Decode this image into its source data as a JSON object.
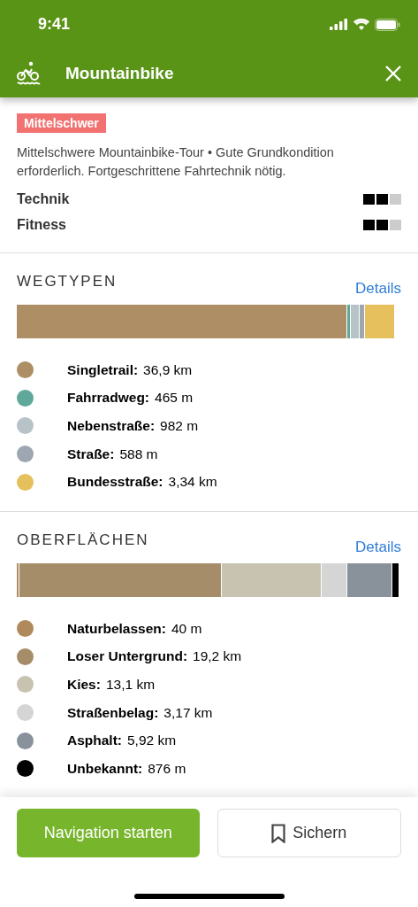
{
  "status_bar": {
    "time": "9:41"
  },
  "header": {
    "title": "Mountainbike"
  },
  "difficulty": {
    "badge": "Mittelschwer",
    "description": "Mittelschwere Mountainbike-Tour • Gute Grundkondition erforderlich. Fortgeschrittene Fahrtechnik nötig.",
    "ratings": [
      {
        "label": "Technik",
        "stars": 2
      },
      {
        "label": "Fitness",
        "stars": 2
      }
    ]
  },
  "sections": [
    {
      "title": "WEGTYPEN",
      "link": "Details",
      "segments": [
        {
          "name": "Singletrail:",
          "value": "36,9 km",
          "color": "#ad8e65"
        },
        {
          "name": "Fahrradweg:",
          "value": "465 m",
          "color": "#5fa89a"
        },
        {
          "name": "Nebenstraße:",
          "value": "982 m",
          "color": "#b8c3c8"
        },
        {
          "name": "Straße:",
          "value": "588 m",
          "color": "#9ea7b1"
        },
        {
          "name": "Bundesstraße:",
          "value": "3,34 km",
          "color": "#e5c05d"
        }
      ]
    },
    {
      "title": "OBERFLÄCHEN",
      "link": "Details",
      "segments": [
        {
          "name": "Naturbelassen:",
          "value": "40 m",
          "color": "#b08a5c"
        },
        {
          "name": "Loser Untergrund:",
          "value": "19,2 km",
          "color": "#a68d6a"
        },
        {
          "name": "Kies:",
          "value": "13,1 km",
          "color": "#c8c2b0"
        },
        {
          "name": "Straßenbelag:",
          "value": "3,17 km",
          "color": "#d5d5d5"
        },
        {
          "name": "Asphalt:",
          "value": "5,92 km",
          "color": "#89929b"
        },
        {
          "name": "Unbekannt:",
          "value": "876 m",
          "color": "#000000"
        }
      ]
    }
  ],
  "actions": {
    "primary": "Navigation starten",
    "secondary": "Sichern"
  }
}
